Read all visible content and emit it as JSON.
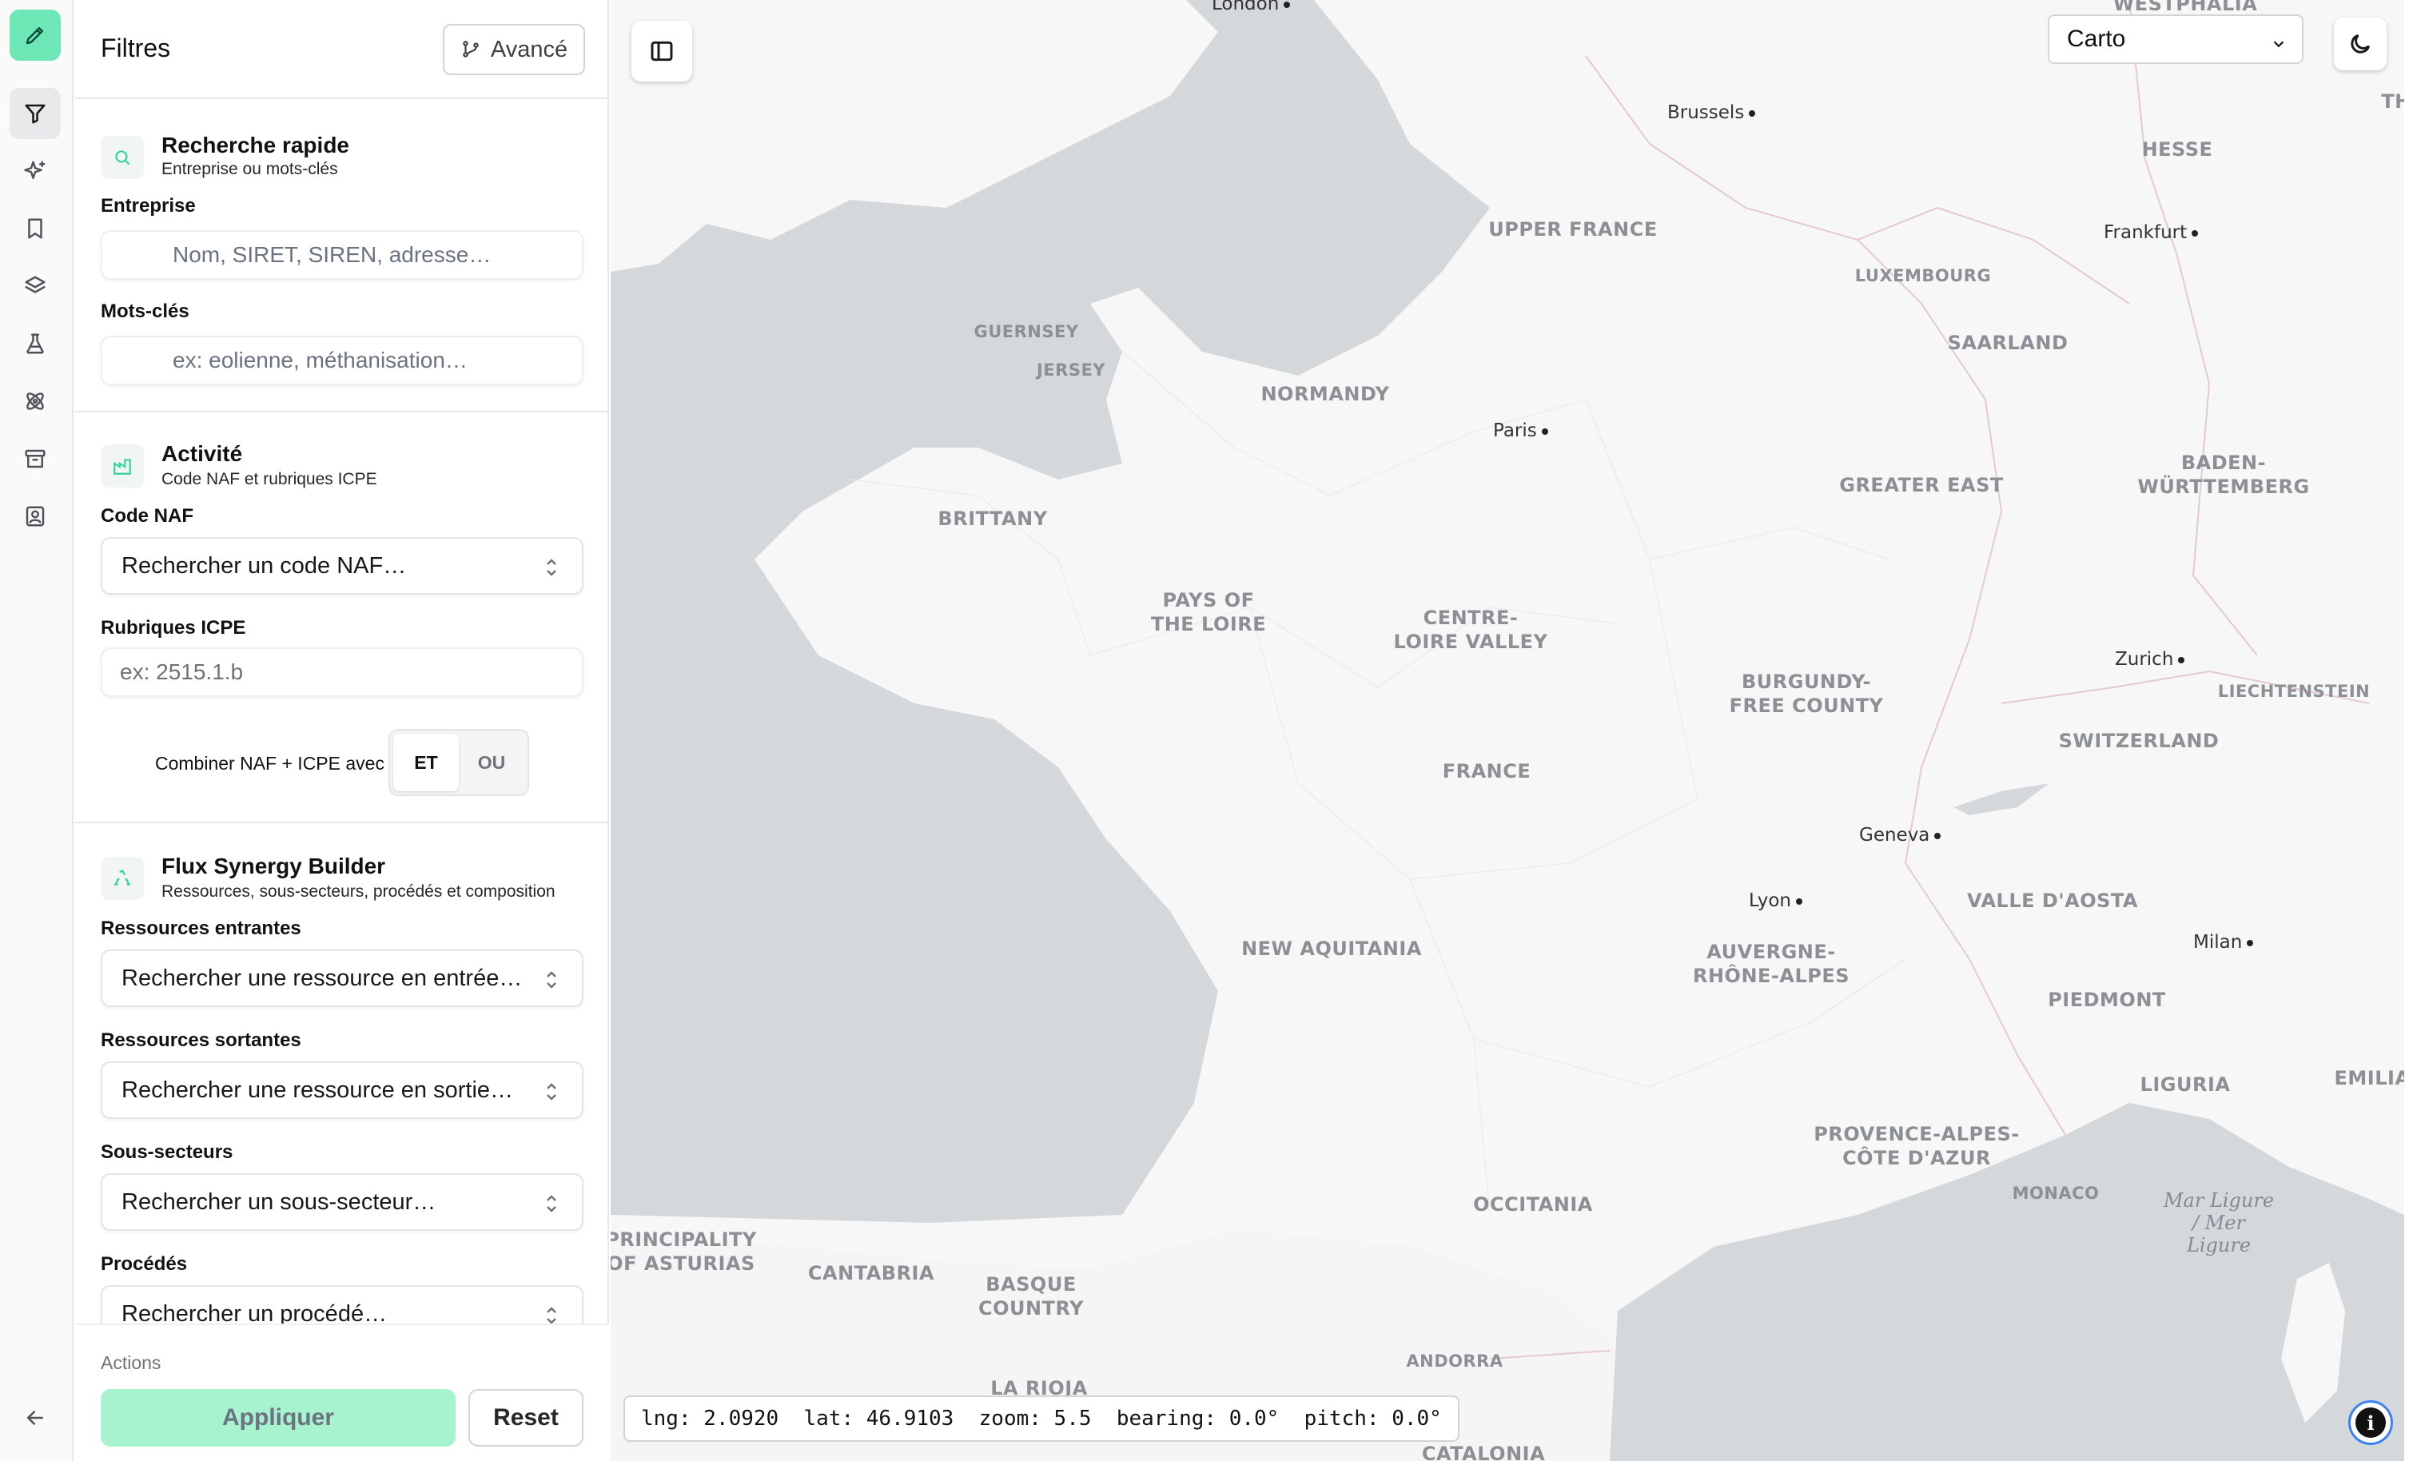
{
  "rail": {
    "items": [
      {
        "name": "brand-pencil",
        "icon": "pencil-icon"
      },
      {
        "name": "filters",
        "icon": "filter-icon"
      },
      {
        "name": "ai-sparkles",
        "icon": "sparkles-icon"
      },
      {
        "name": "bookmarks",
        "icon": "bookmark-icon"
      },
      {
        "name": "layers",
        "icon": "layers-icon"
      },
      {
        "name": "lab",
        "icon": "flask-icon"
      },
      {
        "name": "synergy",
        "icon": "atom-icon"
      },
      {
        "name": "archive",
        "icon": "archive-icon"
      },
      {
        "name": "contacts",
        "icon": "contact-icon"
      },
      {
        "name": "collapse",
        "icon": "arrow-left-icon"
      }
    ],
    "brand_color": "#6ee7b7"
  },
  "panel": {
    "title": "Filtres",
    "advanced_label": "Avancé",
    "quick_search": {
      "title": "Recherche rapide",
      "subtitle": "Entreprise ou mots-clés",
      "company_label": "Entreprise",
      "company_placeholder": "Nom, SIRET, SIREN, adresse…",
      "keywords_label": "Mots-clés",
      "keywords_placeholder": "ex: eolienne, méthanisation…"
    },
    "activity": {
      "title": "Activité",
      "subtitle": "Code NAF et rubriques ICPE",
      "naf_label": "Code NAF",
      "naf_placeholder": "Rechercher un code NAF…",
      "icpe_label": "Rubriques ICPE",
      "icpe_placeholder": "ex: 2515.1.b",
      "combine_label": "Combiner NAF + ICPE avec",
      "combine_options": [
        "ET",
        "OU"
      ],
      "combine_selected": "ET"
    },
    "flux": {
      "title": "Flux Synergy Builder",
      "subtitle": "Ressources, sous-secteurs, procédés et composition",
      "incoming_label": "Ressources entrantes",
      "incoming_placeholder": "Rechercher une ressource en entrée…",
      "outgoing_label": "Ressources sortantes",
      "outgoing_placeholder": "Rechercher une ressource en sortie…",
      "subsectors_label": "Sous-secteurs",
      "subsectors_placeholder": "Rechercher un sous-secteur…",
      "processes_label": "Procédés",
      "processes_placeholder": "Rechercher un procédé…"
    },
    "actions": {
      "label": "Actions",
      "apply": "Appliquer",
      "reset": "Reset"
    }
  },
  "map": {
    "style_selected": "Carto",
    "theme_icon": "moon-icon",
    "sidebar_toggle_icon": "sidebar-icon",
    "info_icon": "info-icon",
    "status": {
      "text": "lng: 2.0920  lat: 46.9103  zoom: 5.5  bearing: 0.0°  pitch: 0.0°"
    },
    "regions": [
      "WESTPHALIA",
      "HESSE",
      "UPPER FRANCE",
      "LUXEMBOURG",
      "SAARLAND",
      "GUERNSEY",
      "JERSEY",
      "NORMANDY",
      "BRITTANY",
      "GREATER EAST",
      "BADEN-\nWÜRTTEMBERG",
      "PAYS OF\nTHE LOIRE",
      "CENTRE-\nLOIRE VALLEY",
      "BURGUNDY-\nFREE COUNTY",
      "LIECHTENSTEIN",
      "SWITZERLAND",
      "FRANCE",
      "VALLE D'AOSTA",
      "NEW AQUITANIA",
      "AUVERGNE-\nRHÔNE-ALPES",
      "PIEDMONT",
      "LIGURIA",
      "EMILIA",
      "PROVENCE-ALPES-\nCÔTE D'AZUR",
      "MONACO",
      "OCCITANIA",
      "PRINCIPALITY\nOF ASTURIAS",
      "CANTABRIA",
      "BASQUE\nCOUNTRY",
      "LA RIOJA",
      "ANDORRA",
      "CATALONIA",
      "TH"
    ],
    "cities": [
      "London",
      "Brussels",
      "Frankfurt",
      "Paris",
      "Zurich",
      "Geneva",
      "Lyon",
      "Milan"
    ],
    "sea": "Mar Ligure\n/ Mer\nLigure"
  }
}
